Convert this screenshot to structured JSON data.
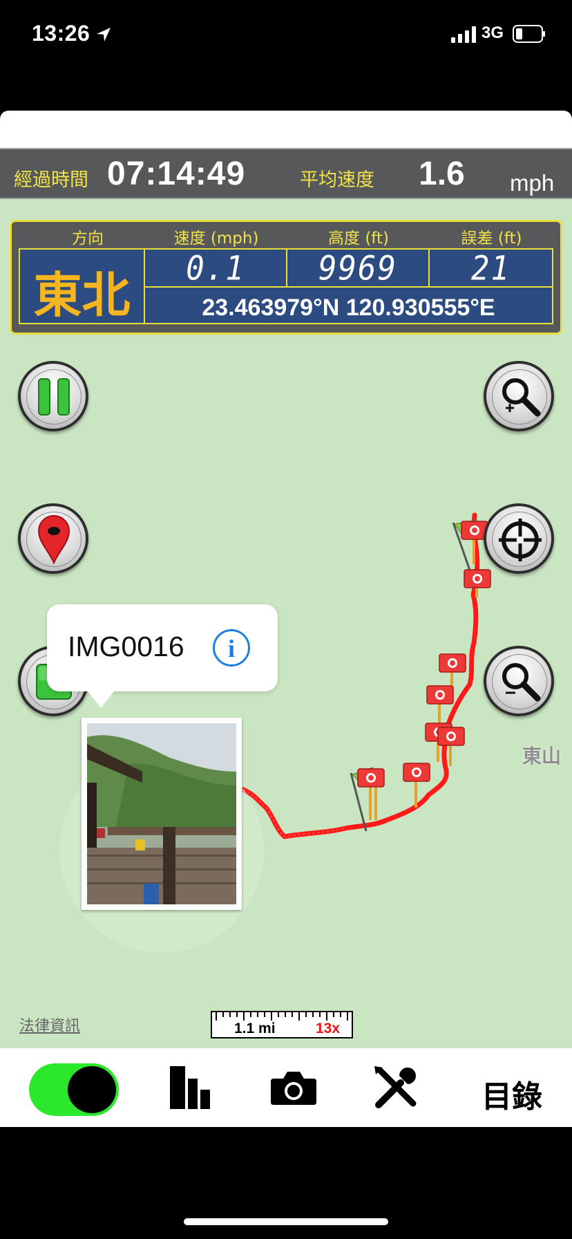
{
  "status_bar": {
    "time": "13:26",
    "network": "3G",
    "icons": [
      "location-arrow-icon",
      "signal-icon",
      "battery-icon"
    ]
  },
  "stats": {
    "elapsed_label": "經過時間",
    "elapsed_value": "07:14:49",
    "avg_speed_label": "平均速度",
    "avg_speed_value": "1.6",
    "avg_speed_unit": "mph"
  },
  "gps": {
    "headers": {
      "direction": "方向",
      "speed": "速度 (mph)",
      "altitude": "高度 (ft)",
      "error": "誤差 (ft)"
    },
    "direction": "東北",
    "speed": "0.1",
    "altitude": "9969",
    "error": "21",
    "coordinates": "23.463979°N 120.930555°E"
  },
  "map": {
    "place_label": "東山",
    "legal_link": "法律資訊",
    "scale": "1.1 mi",
    "zoom": "13x",
    "callout_title": "IMG0016",
    "colors": {
      "map_bg": "#c9e5c1",
      "track": "#ff1a1a",
      "panel": "#56585a",
      "accent": "#f2e34a"
    },
    "buttons": [
      "pause-button",
      "drop-pin-button",
      "stop-button",
      "zoom-in-button",
      "locate-button",
      "zoom-out-button"
    ]
  },
  "tab_bar": {
    "toggle_state": "on",
    "catalog_label": "目錄",
    "icons": [
      "stats-bar-chart-icon",
      "camera-icon",
      "tools-icon"
    ]
  }
}
